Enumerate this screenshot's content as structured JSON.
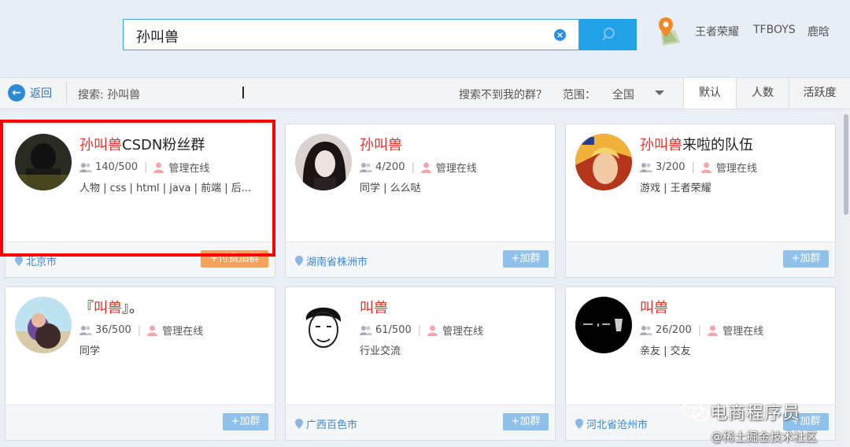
{
  "search": {
    "query": "孙叫兽"
  },
  "hot_keywords": [
    "王者荣耀",
    "TFBOYS",
    "鹿晗"
  ],
  "filterbar": {
    "back_label": "返回",
    "crumb": "搜索: 孙叫兽",
    "not_found": "搜索不到我的群？",
    "range_label": "范围：",
    "range_value": "全国",
    "tabs": [
      "默认",
      "人数",
      "活跃度"
    ],
    "active_tab": "默认"
  },
  "cards": [
    {
      "title_hl": "孙叫兽",
      "title_rest": "CSDN粉丝群",
      "members": "140/500",
      "admin": "管理在线",
      "tags": "人物 | css | html | java | 前端 | 后...",
      "city": "北京市",
      "join": "+付费加群",
      "avatar": "dark-hoodie"
    },
    {
      "title_hl": "孙叫兽",
      "title_rest": "",
      "members": "4/200",
      "admin": "管理在线",
      "tags": "同学 | 么么哒",
      "city": "湖南省株洲市",
      "join": "+加群",
      "avatar": "girl"
    },
    {
      "title_hl": "孙叫兽",
      "title_rest": "来啦的队伍",
      "members": "3/200",
      "admin": "管理在线",
      "tags": "游戏 | 王者荣耀",
      "city": "",
      "join": "+加群",
      "avatar": "game-hero"
    },
    {
      "title_pre": "『",
      "title_hl": "叫兽",
      "title_rest": "』。",
      "members": "36/500",
      "admin": "管理在线",
      "tags": "同学",
      "city": "",
      "join": "+加群",
      "avatar": "beach-kid"
    },
    {
      "title_hl": "叫兽",
      "title_rest": "",
      "members": "61/500",
      "admin": "管理在线",
      "tags": "行业交流",
      "city": "广西百色市",
      "join": "+加群",
      "avatar": "sketch-face"
    },
    {
      "title_hl": "叫兽",
      "title_rest": "",
      "members": "26/200",
      "admin": "管理在线",
      "tags": "亲友 | 交友",
      "city": "河北省沧州市",
      "join": "+加群",
      "avatar": "black-logo"
    }
  ],
  "watermark": {
    "line1": "电商程序员",
    "line2": "@稀土掘金技术社区"
  }
}
